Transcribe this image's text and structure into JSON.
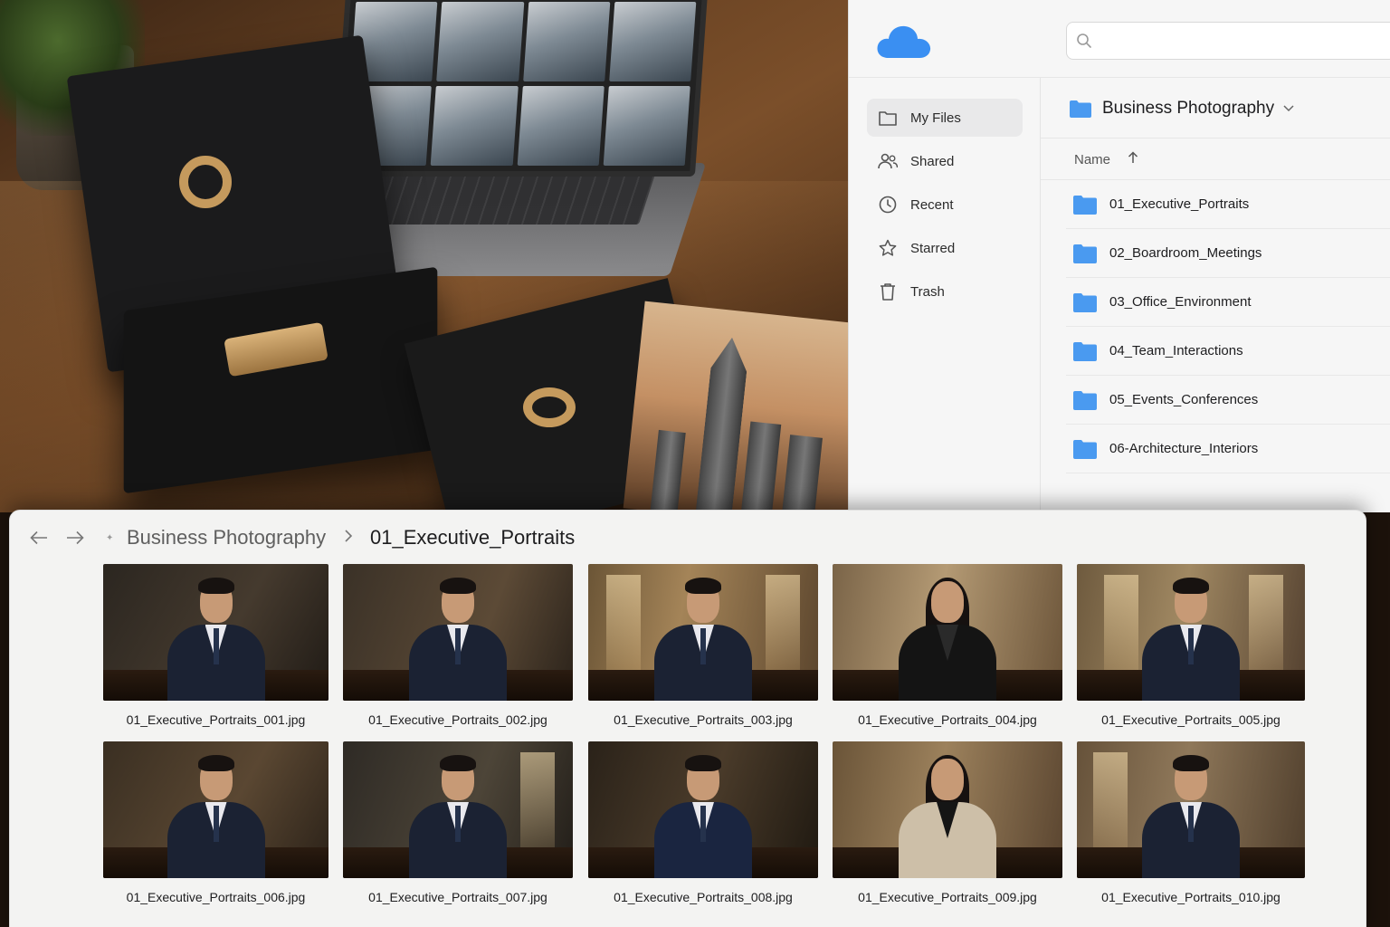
{
  "drive": {
    "search": {
      "placeholder": ""
    },
    "sidebar": {
      "items": [
        {
          "label": "My Files",
          "icon": "folder-icon",
          "active": true
        },
        {
          "label": "Shared",
          "icon": "people-icon",
          "active": false
        },
        {
          "label": "Recent",
          "icon": "clock-icon",
          "active": false
        },
        {
          "label": "Starred",
          "icon": "star-icon",
          "active": false
        },
        {
          "label": "Trash",
          "icon": "trash-icon",
          "active": false
        }
      ]
    },
    "folder_title": "Business Photography",
    "sort_label": "Name",
    "folders": [
      "01_Executive_Portraits",
      "02_Boardroom_Meetings",
      "03_Office_Environment",
      "04_Team_Interactions",
      "05_Events_Conferences",
      "06-Architecture_Interiors"
    ]
  },
  "gallery": {
    "breadcrumb": {
      "parent": "Business Photography",
      "current": "01_Executive_Portraits"
    },
    "files": [
      "01_Executive_Portraits_001.jpg",
      "01_Executive_Portraits_002.jpg",
      "01_Executive_Portraits_003.jpg",
      "01_Executive_Portraits_004.jpg",
      "01_Executive_Portraits_005.jpg",
      "01_Executive_Portraits_006.jpg",
      "01_Executive_Portraits_007.jpg",
      "01_Executive_Portraits_008.jpg",
      "01_Executive_Portraits_009.jpg",
      "01_Executive_Portraits_010.jpg"
    ]
  },
  "colors": {
    "accent_blue": "#3a8ff2",
    "folder_blue": "#4a9af0",
    "gold": "#c59a5d"
  }
}
